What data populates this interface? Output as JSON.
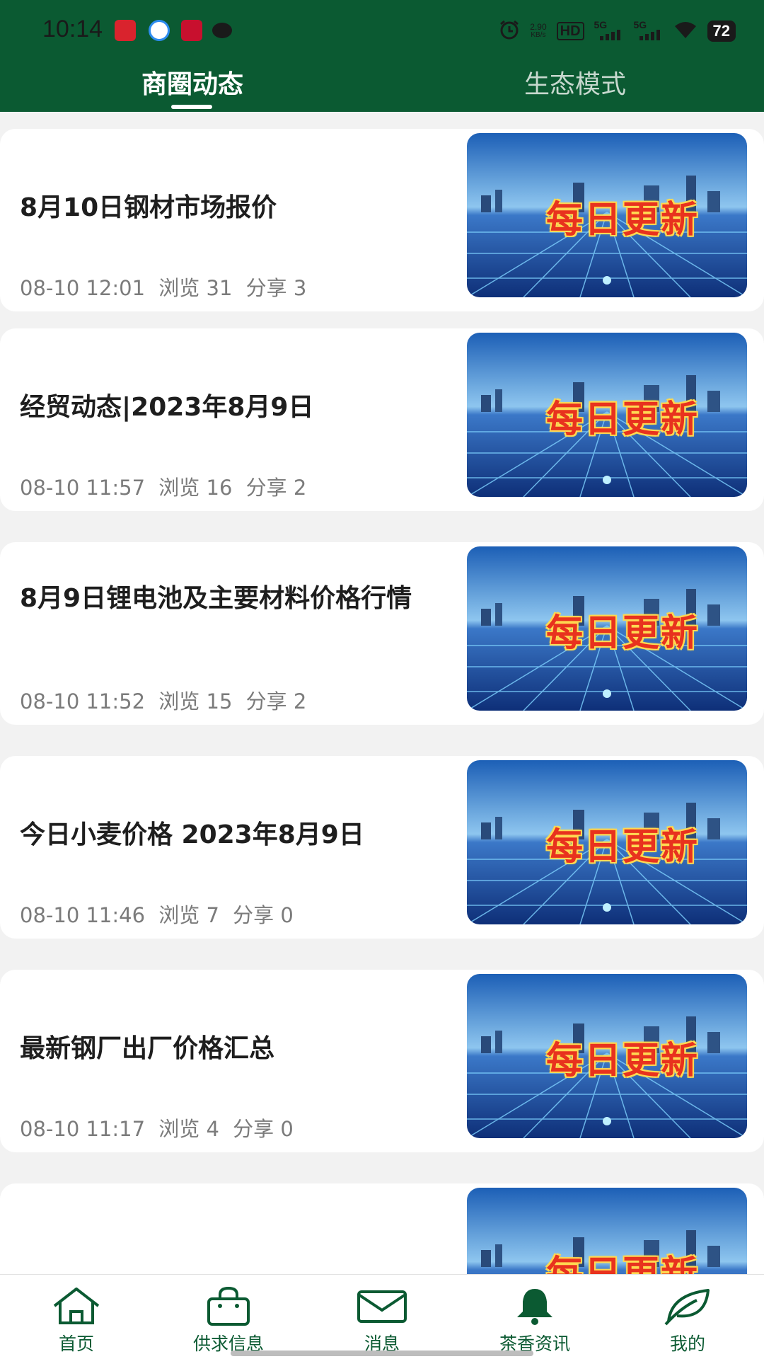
{
  "status_bar": {
    "time": "10:14",
    "net_speed_value": "2.90",
    "net_speed_unit": "KB/s",
    "hd": "HD",
    "sig1": "5G",
    "sig2": "5G",
    "battery": "72"
  },
  "tabs": {
    "active": "商圈动态",
    "inactive": "生态模式"
  },
  "thumbnail_text": "每日更新",
  "articles": [
    {
      "title": "8月10日钢材市场报价",
      "date": "08-10 12:01",
      "views": "浏览 31",
      "shares": "分享 3"
    },
    {
      "title": "经贸动态|2023年8月9日",
      "date": "08-10 11:57",
      "views": "浏览 16",
      "shares": "分享 2"
    },
    {
      "title": "8月9日锂电池及主要材料价格行情",
      "date": "08-10 11:52",
      "views": "浏览 15",
      "shares": "分享 2"
    },
    {
      "title": "今日小麦价格 2023年8月9日",
      "date": "08-10 11:46",
      "views": "浏览 7",
      "shares": "分享 0"
    },
    {
      "title": "最新钢厂出厂价格汇总",
      "date": "08-10 11:17",
      "views": "浏览 4",
      "shares": "分享 0"
    }
  ],
  "bottom_nav": [
    {
      "label": "首页",
      "icon": "home-icon"
    },
    {
      "label": "供求信息",
      "icon": "bag-icon"
    },
    {
      "label": "消息",
      "icon": "mail-icon"
    },
    {
      "label": "茶香资讯",
      "icon": "bell-icon"
    },
    {
      "label": "我的",
      "icon": "leaf-icon"
    }
  ],
  "colors": {
    "header": "#0b5a32",
    "accent": "#0b5a32",
    "thumbnail_text": "#e8321e"
  }
}
